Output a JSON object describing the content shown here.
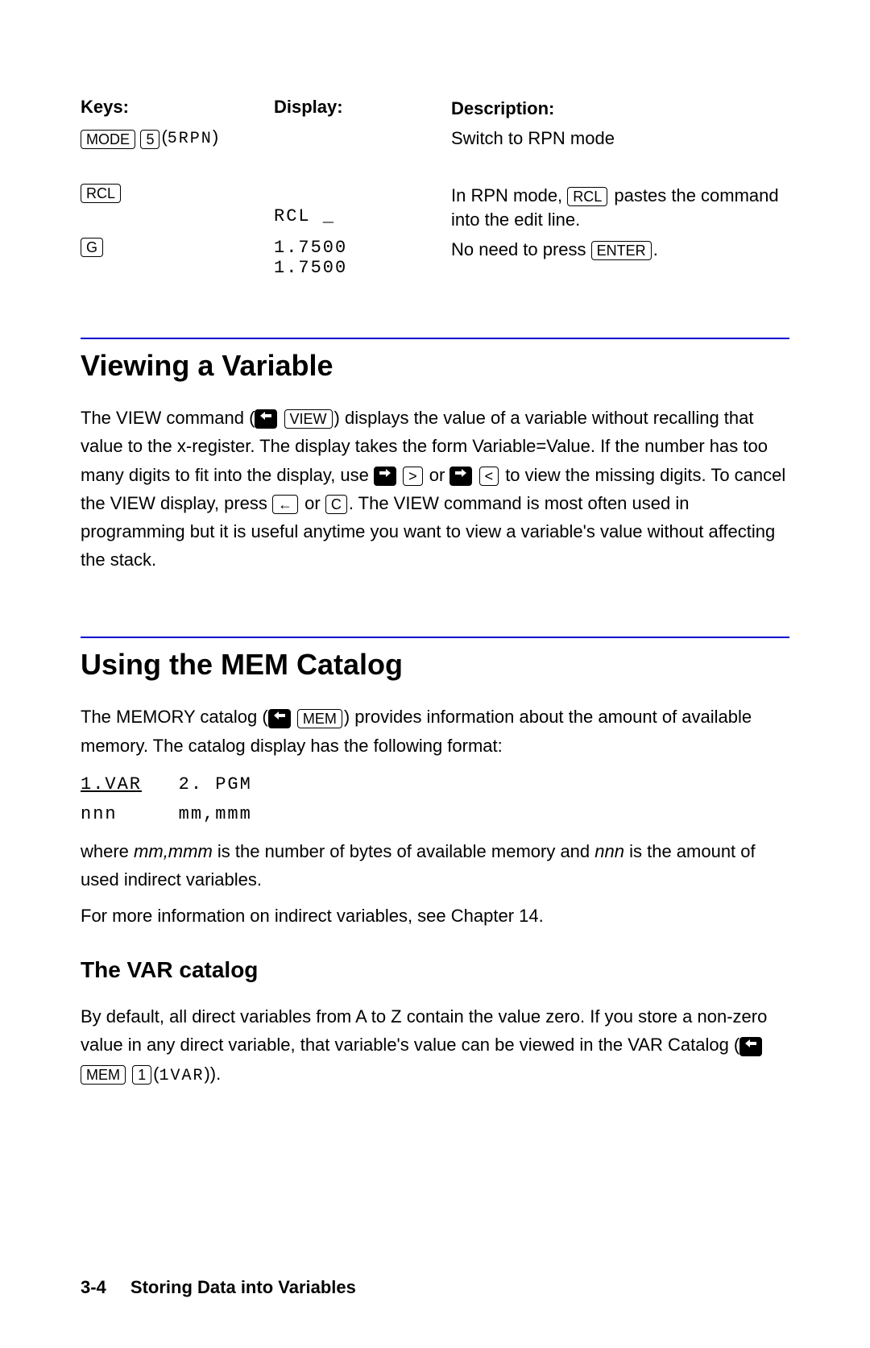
{
  "table": {
    "headers": {
      "keys": "Keys:",
      "display": "Display:",
      "desc": "Description:"
    },
    "rows": [
      {
        "keys": {
          "k1": "MODE",
          "k2": "5",
          "suffix": "5RPN"
        },
        "display": "",
        "desc_a": "Switch to RPN mode"
      },
      {
        "keys": {
          "k1": "RCL"
        },
        "display": "RCL _",
        "desc_a": "In RPN mode, ",
        "desc_key": "RCL",
        "desc_b": " pastes the command into the edit line."
      },
      {
        "keys": {
          "k1": "G"
        },
        "display_a": "1.7500",
        "display_b": "1.7500",
        "desc_a": "No need to press ",
        "desc_key": "ENTER",
        "desc_b": "."
      }
    ]
  },
  "section1": {
    "title": "Viewing a Variable",
    "p1a": "The VIEW command (",
    "p1_key1": "VIEW",
    "p1b": ") displays the value of a variable without recalling that value to the x-register. The display takes the form Variable=Value.  If the number has too many digits to fit into the display, use ",
    "p1_key2": ">",
    "p1c": " or ",
    "p1_key3": "<",
    "p1d": " to view the missing digits. To cancel the VIEW display, press ",
    "p1_key4": "←",
    "p1e": " or ",
    "p1_key5": "C",
    "p1f": ". The VIEW command is most often used in programming but it is useful anytime you want to view a variable's value without affecting the stack."
  },
  "section2": {
    "title": "Using the MEM Catalog",
    "p1a": "The MEMORY catalog (",
    "p1_key1": "MEM",
    "p1b": ") provides information about the amount of available memory. The catalog display has the following format:",
    "mono1a": "1.VAR",
    "mono1b": "2. PGM",
    "mono2a": "nnn",
    "mono2b": "mm,mmm",
    "p2a": "where ",
    "p2_i1": "mm,mmm",
    "p2b": " is the number of bytes of available memory and ",
    "p2_i2": "nnn",
    "p2c": " is the amount of used indirect variables.",
    "p3": "For more information on indirect variables, see Chapter 14."
  },
  "section3": {
    "title": "The VAR catalog",
    "p1a": "By default, all direct variables from A to Z contain the value zero.  If you store a non-zero value in any direct variable, that variable's value can be viewed in the VAR Catalog (",
    "p1_key1": "MEM",
    "p1_key2": "1",
    "p1_suffix": "1VAR",
    "p1b": "))."
  },
  "footer": {
    "page": "3-4",
    "title": "Storing Data into Variables"
  }
}
